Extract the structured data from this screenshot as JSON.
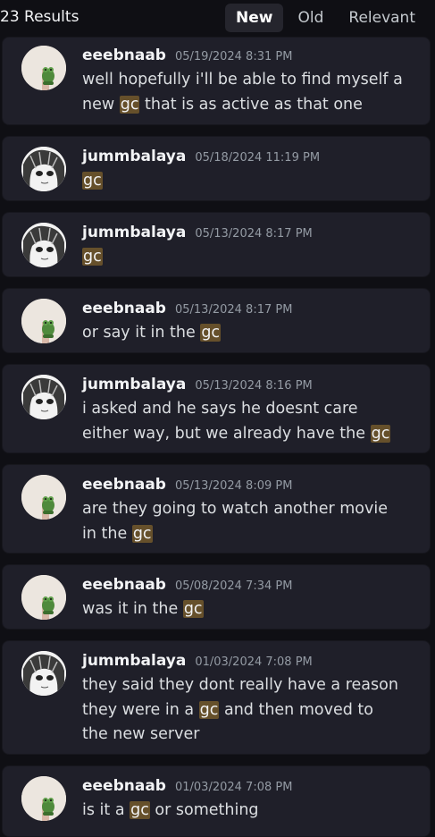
{
  "header": {
    "results_count": "23 Results",
    "tabs": [
      {
        "label": "New",
        "active": true
      },
      {
        "label": "Old",
        "active": false
      },
      {
        "label": "Relevant",
        "active": false
      }
    ]
  },
  "messages": [
    {
      "author": "eeebnaab",
      "timestamp": "05/19/2024 8:31 PM",
      "avatar": "frog-avatar",
      "segments": [
        {
          "t": "well hopefully i'll be able to find myself a new "
        },
        {
          "t": "gc",
          "hl": true
        },
        {
          "t": " that is as active as that one"
        }
      ]
    },
    {
      "author": "jummbalaya",
      "timestamp": "05/18/2024 11:19 PM",
      "avatar": "anime-avatar",
      "segments": [
        {
          "t": "gc",
          "hl": true
        }
      ]
    },
    {
      "author": "jummbalaya",
      "timestamp": "05/13/2024 8:17 PM",
      "avatar": "anime-avatar",
      "segments": [
        {
          "t": "gc",
          "hl": true
        }
      ]
    },
    {
      "author": "eeebnaab",
      "timestamp": "05/13/2024 8:17 PM",
      "avatar": "frog-avatar",
      "segments": [
        {
          "t": "or say it in the "
        },
        {
          "t": "gc",
          "hl": true
        }
      ]
    },
    {
      "author": "jummbalaya",
      "timestamp": "05/13/2024 8:16 PM",
      "avatar": "anime-avatar",
      "segments": [
        {
          "t": "i asked and he says he doesnt care either way, but we already have the "
        },
        {
          "t": "gc",
          "hl": true
        }
      ]
    },
    {
      "author": "eeebnaab",
      "timestamp": "05/13/2024 8:09 PM",
      "avatar": "frog-avatar",
      "segments": [
        {
          "t": "are they going to watch another movie in the "
        },
        {
          "t": "gc",
          "hl": true
        }
      ]
    },
    {
      "author": "eeebnaab",
      "timestamp": "05/08/2024 7:34 PM",
      "avatar": "frog-avatar",
      "segments": [
        {
          "t": "was it in the "
        },
        {
          "t": "gc",
          "hl": true
        }
      ]
    },
    {
      "author": "jummbalaya",
      "timestamp": "01/03/2024 7:08 PM",
      "avatar": "anime-avatar",
      "segments": [
        {
          "t": "they said they dont really have a reason they were in a "
        },
        {
          "t": "gc",
          "hl": true
        },
        {
          "t": " and then moved to the new server"
        }
      ]
    },
    {
      "author": "eeebnaab",
      "timestamp": "01/03/2024 7:08 PM",
      "avatar": "frog-avatar",
      "segments": [
        {
          "t": "is it a "
        },
        {
          "t": "gc",
          "hl": true
        },
        {
          "t": " or something"
        }
      ]
    }
  ]
}
